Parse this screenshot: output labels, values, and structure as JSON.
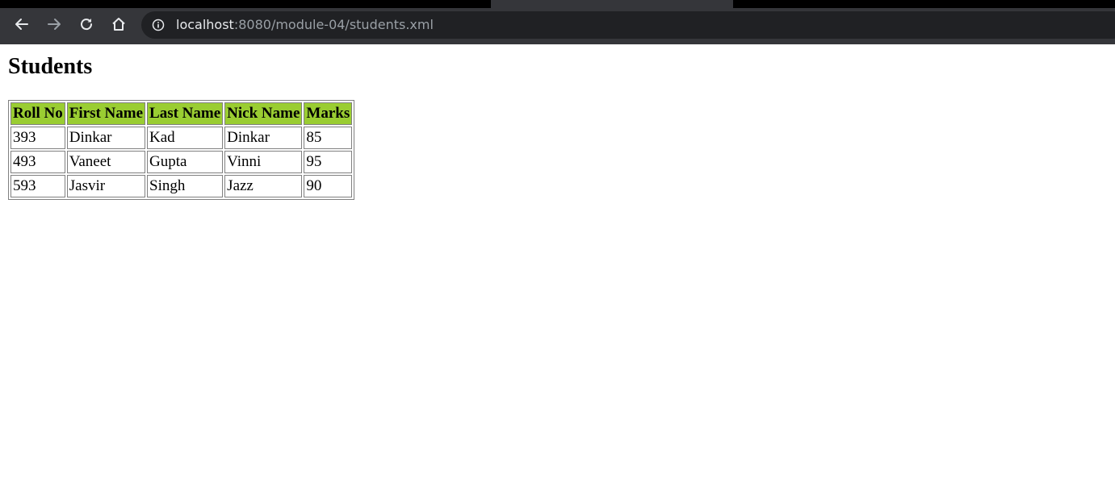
{
  "browser": {
    "url_host": "localhost",
    "url_rest": ":8080/module-04/students.xml",
    "icons": {
      "back": "back-arrow-icon",
      "forward": "forward-arrow-icon",
      "reload": "reload-icon",
      "home": "home-icon",
      "info": "info-icon"
    }
  },
  "page": {
    "title": "Students",
    "table": {
      "header_color": "#9acd32",
      "headers": [
        "Roll No",
        "First Name",
        "Last Name",
        "Nick Name",
        "Marks"
      ],
      "rows": [
        [
          "393",
          "Dinkar",
          "Kad",
          "Dinkar",
          "85"
        ],
        [
          "493",
          "Vaneet",
          "Gupta",
          "Vinni",
          "95"
        ],
        [
          "593",
          "Jasvir",
          "Singh",
          "Jazz",
          "90"
        ]
      ]
    }
  }
}
